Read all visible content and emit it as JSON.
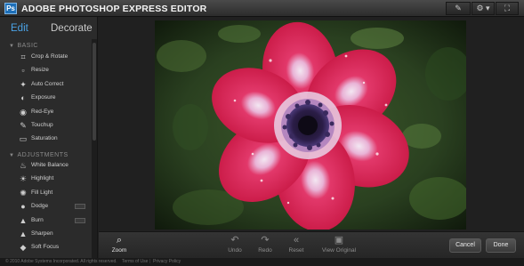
{
  "app": {
    "logo_text": "Ps",
    "title": "ADOBE PHOTOSHOP EXPRESS EDITOR"
  },
  "titlebar_buttons": [
    {
      "name": "brush-tool-icon",
      "glyph": "✎"
    },
    {
      "name": "gear-menu-icon",
      "glyph": "⚙ ▾"
    },
    {
      "name": "fullscreen-icon",
      "glyph": "⛶"
    }
  ],
  "tabs": {
    "edit": "Edit",
    "decorate": "Decorate"
  },
  "sections": {
    "basic": "BASIC",
    "adjustments": "ADJUSTMENTS"
  },
  "basic_tools": [
    {
      "label": "Crop & Rotate",
      "icon": "crop-icon",
      "glyph": "⌗"
    },
    {
      "label": "Resize",
      "icon": "resize-icon",
      "glyph": "▫"
    },
    {
      "label": "Auto Correct",
      "icon": "wand-icon",
      "glyph": "✦"
    },
    {
      "label": "Exposure",
      "icon": "exposure-icon",
      "glyph": "◐"
    },
    {
      "label": "Red-Eye",
      "icon": "eye-icon",
      "glyph": "◉"
    },
    {
      "label": "Touchup",
      "icon": "touchup-icon",
      "glyph": "✎"
    },
    {
      "label": "Saturation",
      "icon": "saturation-icon",
      "glyph": "▭"
    }
  ],
  "adjustment_tools": [
    {
      "label": "White Balance",
      "icon": "thermometer-icon",
      "glyph": "♨"
    },
    {
      "label": "Highlight",
      "icon": "bulb-icon",
      "glyph": "☀"
    },
    {
      "label": "Fill Light",
      "icon": "fill-light-icon",
      "glyph": "✺"
    },
    {
      "label": "Dodge",
      "icon": "dodge-icon",
      "glyph": "●"
    },
    {
      "label": "Burn",
      "icon": "burn-icon",
      "glyph": "▲"
    },
    {
      "label": "Sharpen",
      "icon": "sharpen-icon",
      "glyph": "▲"
    },
    {
      "label": "Soft Focus",
      "icon": "drop-icon",
      "glyph": "◆"
    }
  ],
  "bottom": {
    "zoom": "Zoom",
    "undo": "Undo",
    "redo": "Redo",
    "reset": "Reset",
    "view_original": "View Original",
    "cancel": "Cancel",
    "done": "Done"
  },
  "footer": {
    "copyright": "© 2010 Adobe Systems Incorporated. All rights reserved.",
    "terms": "Terms of Use",
    "privacy": "Privacy Policy"
  },
  "colors": {
    "accent": "#4ba3e6",
    "petal": "#d8234f",
    "background": "#1f1f1f"
  }
}
